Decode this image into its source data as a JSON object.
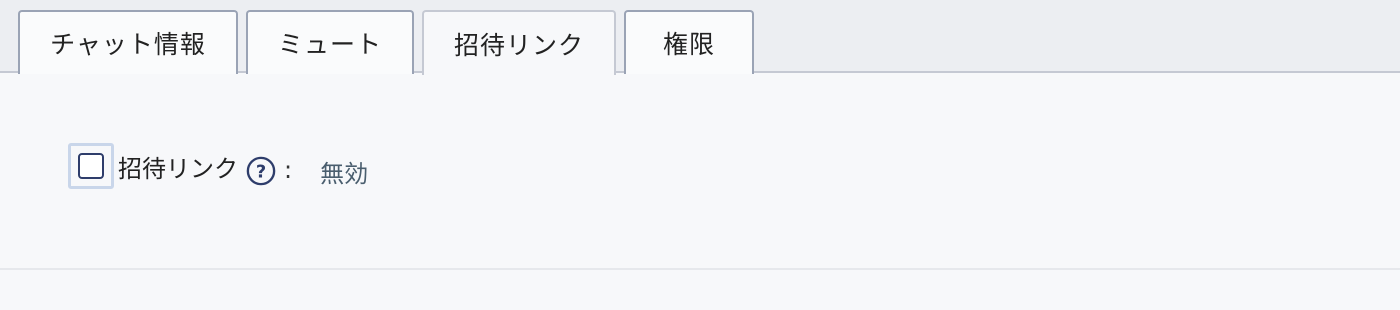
{
  "tabs": [
    {
      "label": "チャット情報",
      "active": false
    },
    {
      "label": "ミュート",
      "active": false
    },
    {
      "label": "招待リンク",
      "active": true
    },
    {
      "label": "権限",
      "active": false
    }
  ],
  "invite_link": {
    "checked": false,
    "label": "招待リンク",
    "colon": ":",
    "value": "無効",
    "help_icon": "question-circle-icon"
  },
  "colors": {
    "accent": "#2e3d6b",
    "value_text": "#4a5e6e",
    "tab_border": "#9aa3b5"
  }
}
